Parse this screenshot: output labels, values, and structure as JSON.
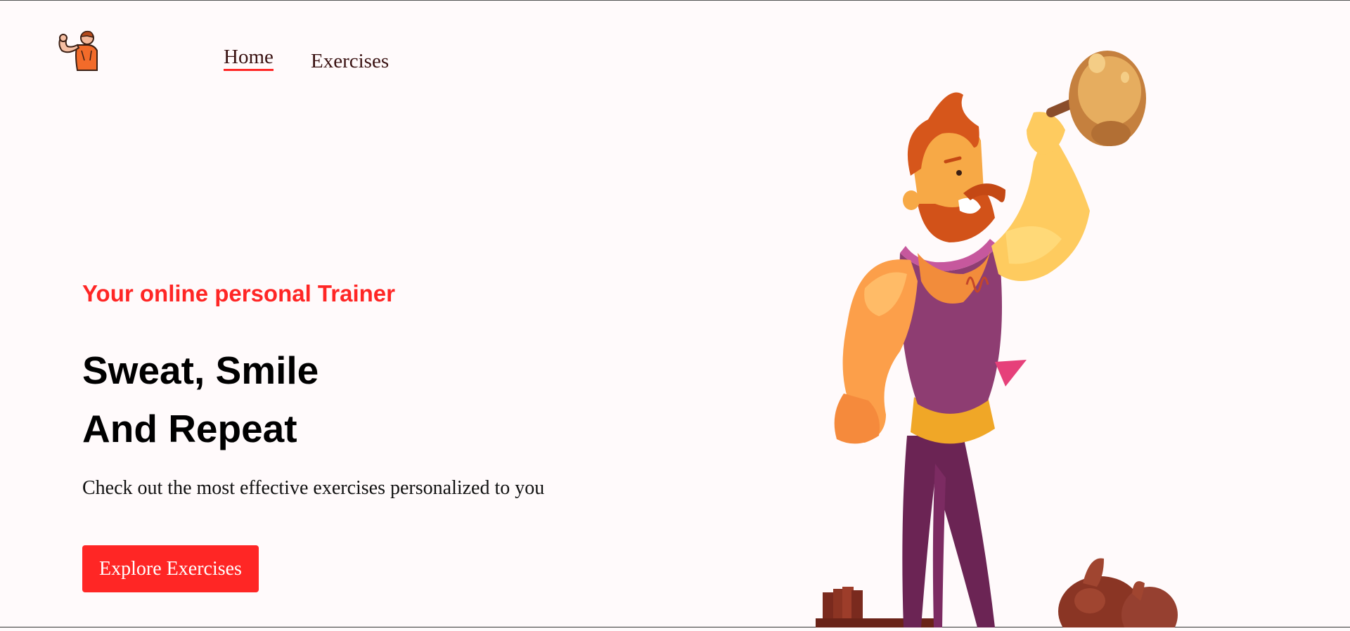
{
  "nav": {
    "logo_icon": "flexing-bodybuilder-logo-icon",
    "links": [
      {
        "label": "Home",
        "active": true
      },
      {
        "label": "Exercises",
        "active": false
      }
    ]
  },
  "hero": {
    "tagline": "Your online personal Trainer",
    "title_line1": "Sweat, Smile",
    "title_line2": "And Repeat",
    "description": "Check out the most effective exercises personalized to you",
    "cta_label": "Explore Exercises",
    "illustration_icon": "strongman-lifting-kettlebell-illustration"
  },
  "colors": {
    "accent": "#ff2625",
    "background": "#fffafb",
    "nav_text": "#3a1212"
  }
}
